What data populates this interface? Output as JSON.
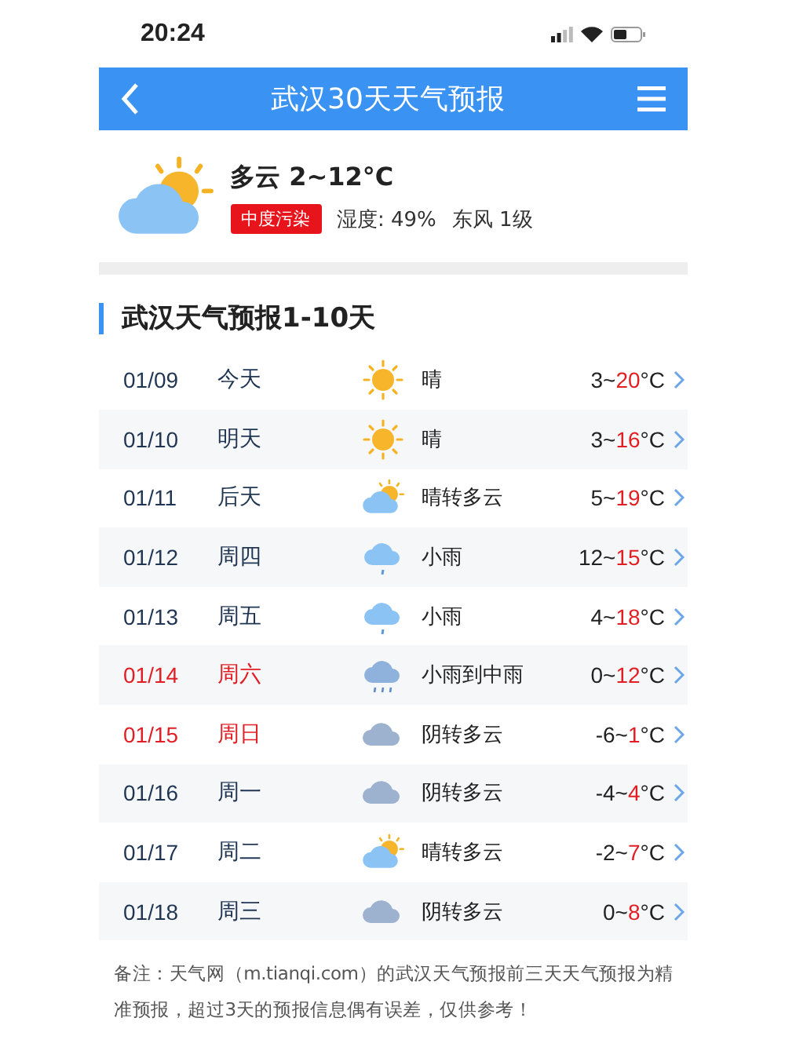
{
  "status_bar": {
    "time": "20:24"
  },
  "header": {
    "title": "武汉30天天气预报"
  },
  "current": {
    "kind": "partly_cloudy",
    "summary": "多云 2~12°C",
    "aqi": "中度污染",
    "humidity": "湿度: 49%",
    "wind": "东风 1级"
  },
  "section": {
    "title": "武汉天气预报1-10天"
  },
  "days": [
    {
      "date": "01/09",
      "day": "今天",
      "weekend": false,
      "kind": "sunny",
      "weather": "晴",
      "low": "3~",
      "high": "20",
      "unit": "°C"
    },
    {
      "date": "01/10",
      "day": "明天",
      "weekend": false,
      "kind": "sunny",
      "weather": "晴",
      "low": "3~",
      "high": "16",
      "unit": "°C"
    },
    {
      "date": "01/11",
      "day": "后天",
      "weekend": false,
      "kind": "partly_cloudy",
      "weather": "晴转多云",
      "low": "5~",
      "high": "19",
      "unit": "°C"
    },
    {
      "date": "01/12",
      "day": "周四",
      "weekend": false,
      "kind": "light_rain",
      "weather": "小雨",
      "low": "12~",
      "high": "15",
      "unit": "°C"
    },
    {
      "date": "01/13",
      "day": "周五",
      "weekend": false,
      "kind": "light_rain",
      "weather": "小雨",
      "low": "4~",
      "high": "18",
      "unit": "°C"
    },
    {
      "date": "01/14",
      "day": "周六",
      "weekend": true,
      "kind": "rain",
      "weather": "小雨到中雨",
      "low": "0~",
      "high": "12",
      "unit": "°C"
    },
    {
      "date": "01/15",
      "day": "周日",
      "weekend": true,
      "kind": "overcast",
      "weather": "阴转多云",
      "low": "-6~",
      "high": "1",
      "unit": "°C"
    },
    {
      "date": "01/16",
      "day": "周一",
      "weekend": false,
      "kind": "overcast",
      "weather": "阴转多云",
      "low": "-4~",
      "high": "4",
      "unit": "°C"
    },
    {
      "date": "01/17",
      "day": "周二",
      "weekend": false,
      "kind": "partly_cloudy",
      "weather": "晴转多云",
      "low": "-2~",
      "high": "7",
      "unit": "°C"
    },
    {
      "date": "01/18",
      "day": "周三",
      "weekend": false,
      "kind": "overcast",
      "weather": "阴转多云",
      "low": "0~",
      "high": "8",
      "unit": "°C"
    }
  ],
  "note": "备注：天气网（m.tianqi.com）的武汉天气预报前三天天气预报为精准预报，超过3天的预报信息偶有误差，仅供参考！"
}
